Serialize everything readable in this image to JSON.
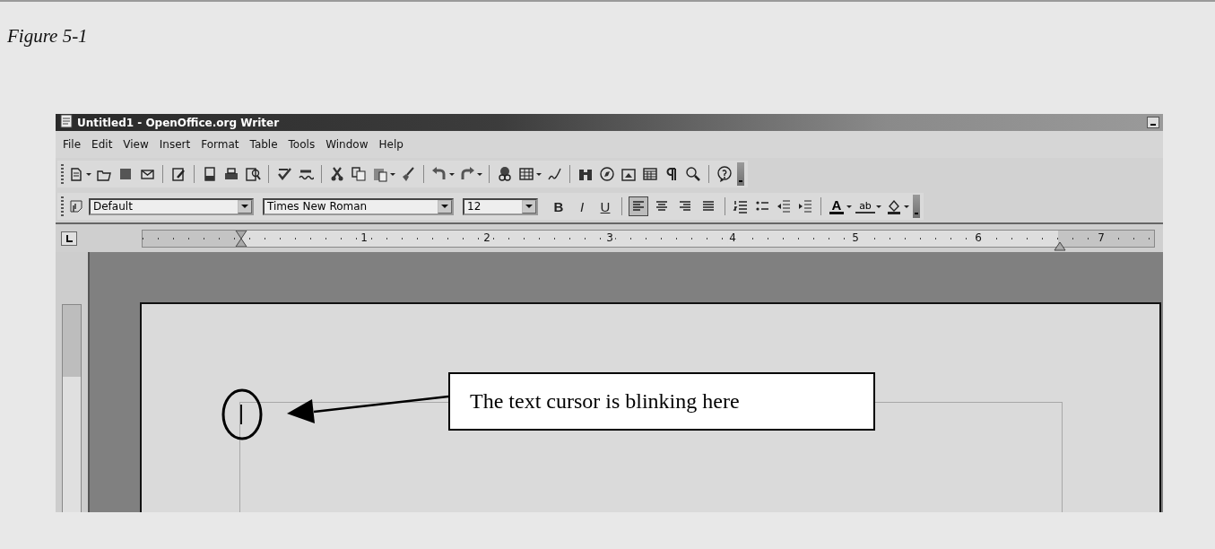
{
  "caption": "Figure 5-1",
  "window": {
    "title": "Untitled1 - OpenOffice.org Writer"
  },
  "menu": [
    "File",
    "Edit",
    "View",
    "Insert",
    "Format",
    "Table",
    "Tools",
    "Window",
    "Help"
  ],
  "formatting": {
    "style": "Default",
    "font": "Times New Roman",
    "size": "12",
    "bold": "B",
    "italic": "I",
    "underline": "U",
    "align": [
      {
        "kind": "left",
        "selected": true
      },
      {
        "kind": "center",
        "selected": false
      },
      {
        "kind": "right",
        "selected": false
      },
      {
        "kind": "justify",
        "selected": false
      }
    ],
    "font_color": "A",
    "highlight": "ab"
  },
  "ruler": [
    "1",
    "2",
    "3",
    "4",
    "5",
    "6",
    "7"
  ],
  "callout": "The text cursor is blinking here"
}
